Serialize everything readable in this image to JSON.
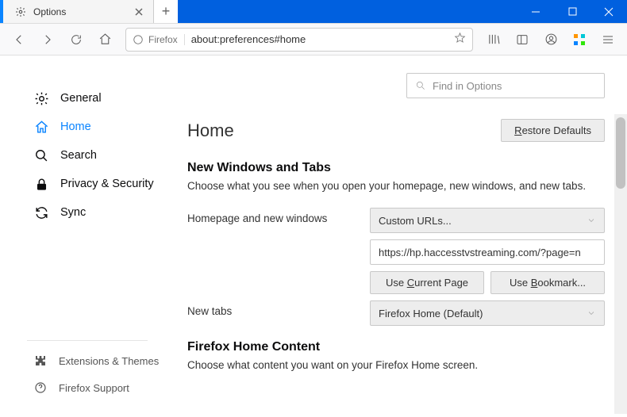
{
  "tab": {
    "title": "Options"
  },
  "urlbar": {
    "identity": "Firefox",
    "url": "about:preferences#home"
  },
  "findPlaceholder": "Find in Options",
  "sidebar": {
    "items": [
      {
        "label": "General"
      },
      {
        "label": "Home"
      },
      {
        "label": "Search"
      },
      {
        "label": "Privacy & Security"
      },
      {
        "label": "Sync"
      }
    ],
    "footer": [
      {
        "label": "Extensions & Themes"
      },
      {
        "label": "Firefox Support"
      }
    ]
  },
  "page": {
    "title": "Home",
    "restoreBtn": {
      "pre": "",
      "ul": "R",
      "post": "estore Defaults"
    },
    "section1": {
      "heading": "New Windows and Tabs",
      "desc": "Choose what you see when you open your homepage, new windows, and new tabs.",
      "row1Label": "Homepage and new windows",
      "row1Select": "Custom URLs...",
      "row1Url": "https://hp.haccesstvstreaming.com/?page=n",
      "useCurrent": {
        "pre": "Use ",
        "ul": "C",
        "post": "urrent Page"
      },
      "useBookmark": {
        "pre": "Use ",
        "ul": "B",
        "post": "ookmark..."
      },
      "row2Label": "New tabs",
      "row2Select": "Firefox Home (Default)"
    },
    "section2": {
      "heading": "Firefox Home Content",
      "desc": "Choose what content you want on your Firefox Home screen."
    }
  }
}
